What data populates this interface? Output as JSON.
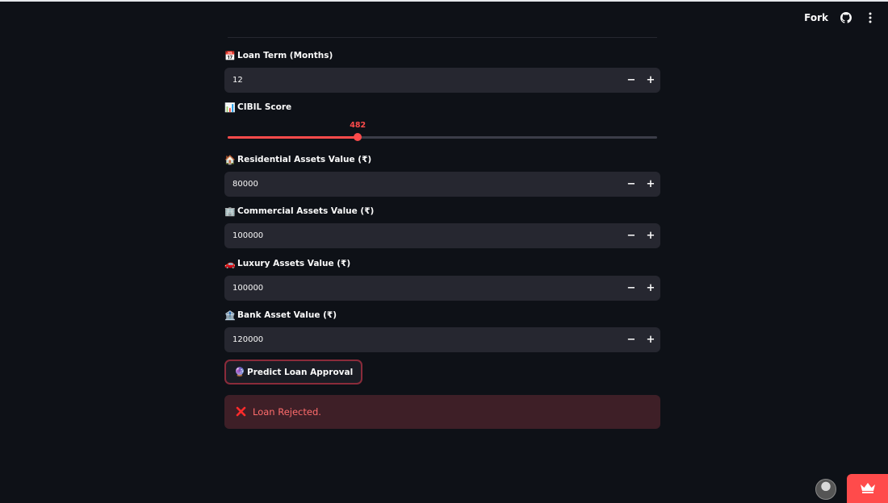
{
  "header": {
    "fork_label": "Fork",
    "github_icon": "github-icon",
    "menu_icon": "kebab-menu-icon"
  },
  "form": {
    "loan_term": {
      "emoji": "📅",
      "label": "Loan Term (Months)",
      "value": "12"
    },
    "cibil": {
      "emoji": "📊",
      "label": "CIBIL Score",
      "value": "482",
      "fraction": 0.303
    },
    "residential": {
      "emoji": "🏠",
      "label": "Residential Assets Value (₹)",
      "value": "80000"
    },
    "commercial": {
      "emoji": "🏢",
      "label": "Commercial Assets Value (₹)",
      "value": "100000"
    },
    "luxury": {
      "emoji": "🚗",
      "label": "Luxury Assets Value (₹)",
      "value": "100000"
    },
    "bank": {
      "emoji": "🏦",
      "label": "Bank Asset Value (₹)",
      "value": "120000"
    },
    "stepper": {
      "minus": "−",
      "plus": "+"
    }
  },
  "predict_button": {
    "emoji": "🔮",
    "label": "Predict Loan Approval"
  },
  "result": {
    "icon": "cross-mark-icon",
    "text": "Loan Rejected."
  },
  "colors": {
    "background": "#0e1117",
    "input_bg": "#262730",
    "accent": "#ff4b4b",
    "error_bg": "#3e1f27",
    "error_text": "#ff6c6c"
  }
}
